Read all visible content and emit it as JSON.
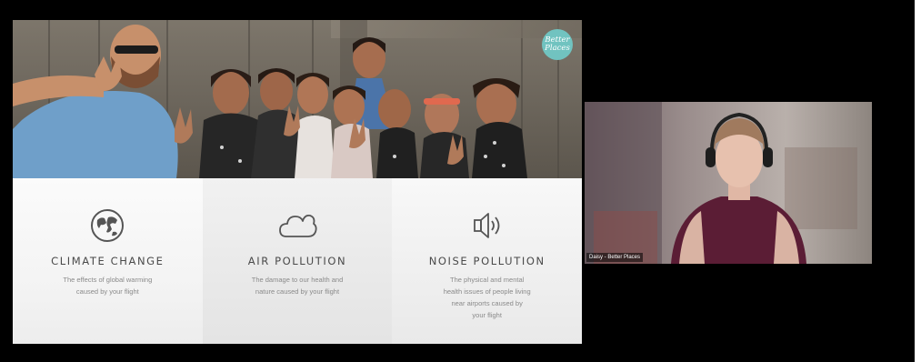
{
  "slide": {
    "brand": {
      "line1": "Better",
      "line2": "Places"
    },
    "photo_icon": "group-photo-children-peace-signs",
    "features": [
      {
        "icon": "globe-icon",
        "title": "CLIMATE CHANGE",
        "description": "The effects of global warming\ncaused by your flight"
      },
      {
        "icon": "cloud-icon",
        "title": "AIR POLLUTION",
        "description": "The damage to our health and\nnature caused by your flight"
      },
      {
        "icon": "speaker-icon",
        "title": "NOISE POLLUTION",
        "description": "The physical and mental\nhealth issues of people living\nnear airports caused by\nyour flight"
      }
    ]
  },
  "participant": {
    "name": "Daisy - Better Places"
  },
  "colors": {
    "background": "#000000",
    "brand_teal": "#71c3c0",
    "slide_text": "#4a4a4a",
    "slide_subtext": "#8a8a8a"
  }
}
